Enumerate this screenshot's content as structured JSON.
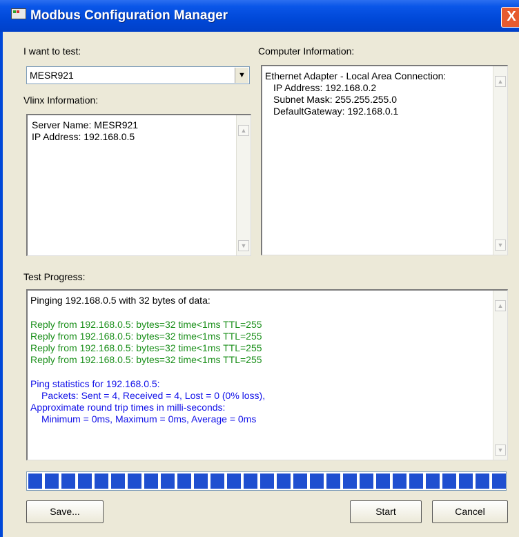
{
  "window": {
    "title": "Modbus Configuration Manager",
    "close_label": "X"
  },
  "test_selector": {
    "label": "I want to test:",
    "selected": "MESR921"
  },
  "vlinx": {
    "label": "Vlinx Information:",
    "lines": [
      "Server Name: MESR921",
      "IP Address: 192.168.0.5"
    ]
  },
  "computer": {
    "label": "Computer Information:",
    "lines": [
      "Ethernet Adapter - Local Area Connection:",
      "IP Address: 192.168.0.2",
      "Subnet Mask: 255.255.255.0",
      "DefaultGateway: 192.168.0.1"
    ]
  },
  "progress_log": {
    "label": "Test Progress:",
    "header": "Pinging 192.168.0.5 with 32 bytes of data:",
    "replies": [
      "Reply from 192.168.0.5: bytes=32 time<1ms TTL=255",
      "Reply from 192.168.0.5: bytes=32 time<1ms TTL=255",
      "Reply from 192.168.0.5: bytes=32 time<1ms TTL=255",
      "Reply from 192.168.0.5: bytes=32 time<1ms TTL=255"
    ],
    "stats": [
      "Ping statistics for 192.168.0.5:",
      "Packets: Sent = 4, Received = 4, Lost = 0 (0% loss),",
      "Approximate round trip times in milli-seconds:",
      "Minimum = 0ms, Maximum = 0ms, Average = 0ms"
    ]
  },
  "progress_bar": {
    "value": 1.0
  },
  "buttons": {
    "save": "Save...",
    "start": "Start",
    "cancel": "Cancel"
  },
  "colors": {
    "reply_text": "#1a8f1a",
    "stats_text": "#1010e8",
    "progress_fill": "#1f4fd0"
  }
}
